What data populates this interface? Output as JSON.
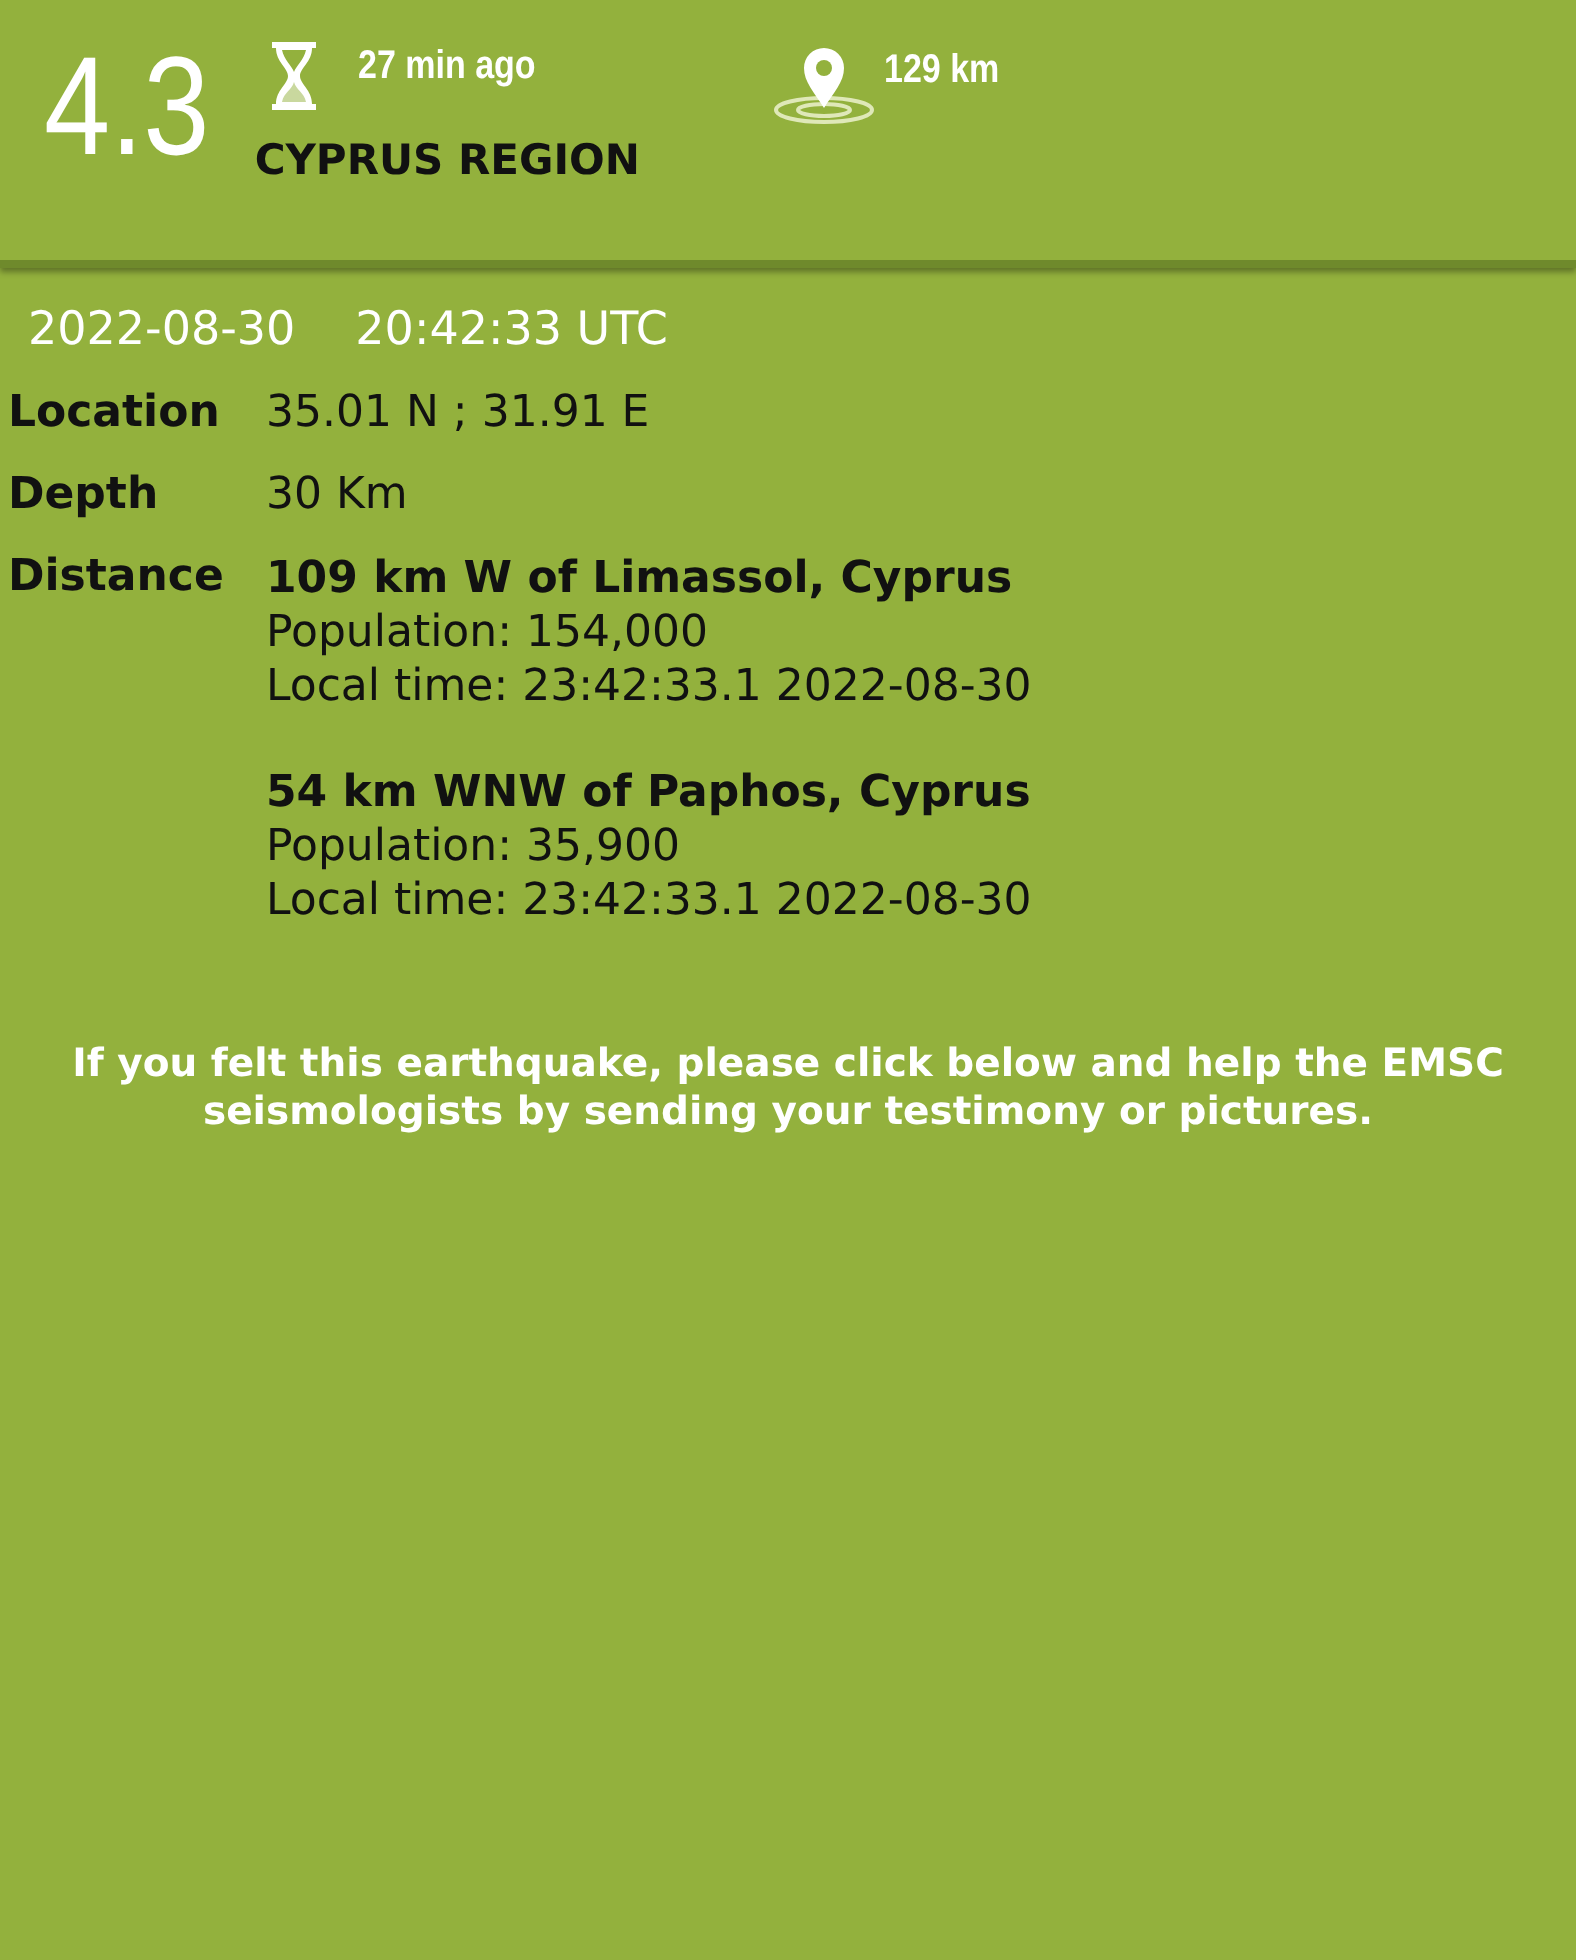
{
  "header": {
    "magnitude": "4.3",
    "time_ago": "27 min ago",
    "region": "CYPRUS REGION",
    "distance": "129 km"
  },
  "datetime": {
    "date": "2022-08-30",
    "time": "20:42:33 UTC"
  },
  "details": [
    {
      "label": "Location",
      "value": "35.01 N ; 31.91 E"
    },
    {
      "label": "Depth",
      "value": "30 Km"
    }
  ],
  "distance": {
    "label": "Distance",
    "places": [
      {
        "place": "109 km W of Limassol, Cyprus",
        "population": "Population: 154,000",
        "local_time": "Local time: 23:42:33.1 2022-08-30"
      },
      {
        "place": "54 km WNW of Paphos, Cyprus",
        "population": "Population: 35,900",
        "local_time": "Local time: 23:42:33.1 2022-08-30"
      }
    ]
  },
  "message": "If you felt this earthquake, please click below and help the EMSC seismologists by sending your testimony or pictures."
}
